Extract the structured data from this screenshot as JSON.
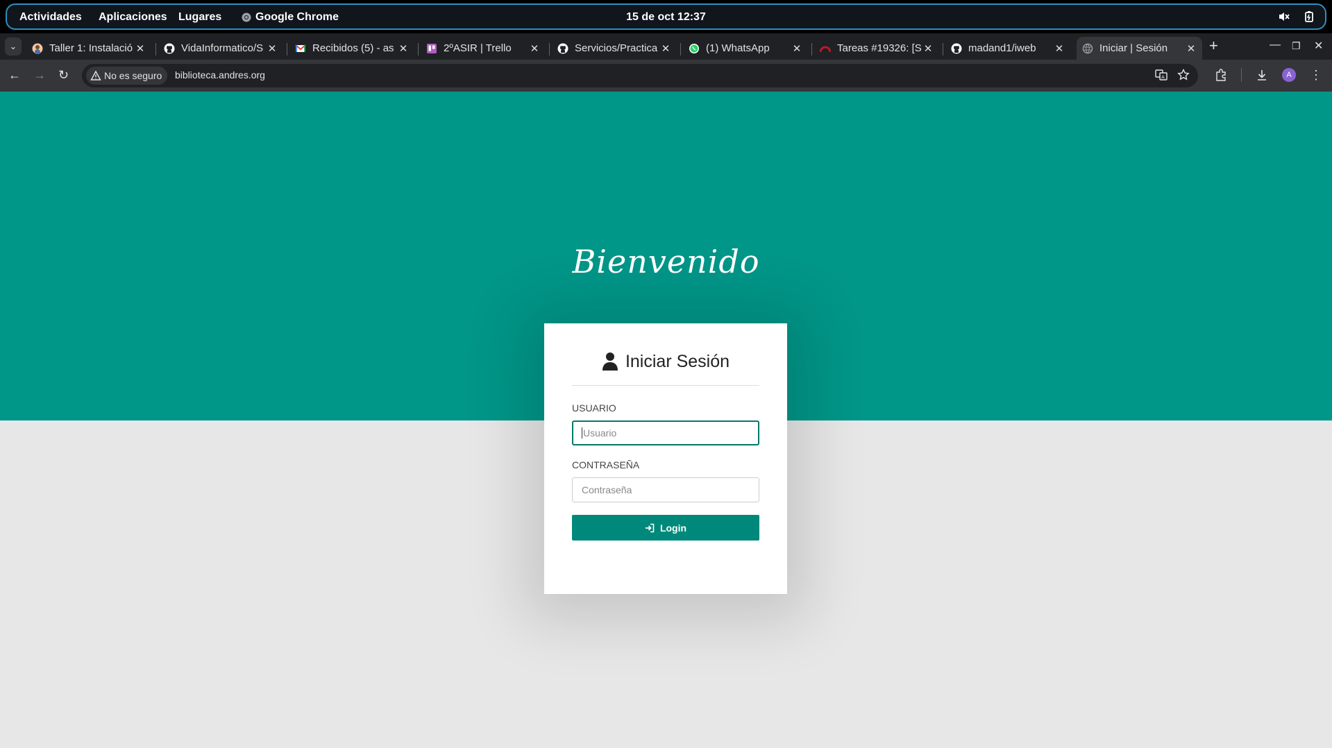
{
  "system_bar": {
    "activities": "Actividades",
    "applications": "Aplicaciones",
    "places": "Lugares",
    "app_name": "Google Chrome",
    "clock": "15 de oct  12:37"
  },
  "tabs": [
    {
      "title": "Taller 1: Instalació",
      "icon": "avatar-favicon",
      "active": false
    },
    {
      "title": "VidaInformatico/S",
      "icon": "github-icon",
      "active": false
    },
    {
      "title": "Recibidos (5) - as",
      "icon": "gmail-icon",
      "active": false
    },
    {
      "title": "2ºASIR | Trello",
      "icon": "trello-icon",
      "active": false
    },
    {
      "title": "Servicios/Practica",
      "icon": "github-icon",
      "active": false
    },
    {
      "title": "(1) WhatsApp",
      "icon": "whatsapp-icon",
      "active": false
    },
    {
      "title": "Tareas #19326: [S",
      "icon": "redmine-icon",
      "active": false
    },
    {
      "title": "madand1/iweb",
      "icon": "github-icon",
      "active": false
    },
    {
      "title": "Iniciar | Sesión",
      "icon": "globe-icon",
      "active": true
    }
  ],
  "address_bar": {
    "security_label": "No es seguro",
    "url": "biblioteca.andres.org"
  },
  "profile_initial": "A",
  "page": {
    "welcome": "Bienvenido",
    "login_title": "Iniciar Sesión",
    "user_label": "USUARIO",
    "user_placeholder": "Usuario",
    "password_label": "CONTRASEÑA",
    "password_placeholder": "Contraseña",
    "login_button": "Login"
  },
  "colors": {
    "hero": "#009688",
    "button": "#00897b",
    "background": "#e7e7e7"
  }
}
